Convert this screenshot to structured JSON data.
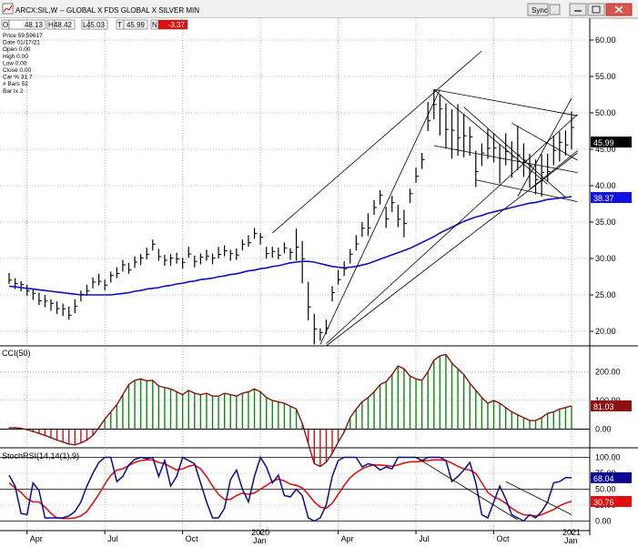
{
  "window": {
    "title": "ARCX:SIL,W -- GLOBAL X FDS GLOBAL X SILVER MIN",
    "sync_label": "Sync"
  },
  "ohlc_bar": {
    "labels": [
      "O",
      "H",
      "L",
      "T",
      "N"
    ],
    "values": [
      "48.13",
      "48.42",
      "45.03",
      "45.99",
      "-3.37"
    ]
  },
  "info_panel": [
    "Price  59.59617",
    "Date  01/17/21",
    "Open  0.00",
    "High  0.00",
    "Low  0.00",
    "Close  0.00",
    "Car %  31.7",
    "# Bars  52",
    "Bar Ix  2"
  ],
  "colors": {
    "ma": "#1010c0",
    "cci_up": "#0a8a0a",
    "cci_down": "#d01010",
    "cci_line": "#8b1010",
    "stoch_k": "#0a0a90",
    "stoch_d": "#e01010",
    "neg_box": "#e01010"
  },
  "chart_data": [
    {
      "type": "ohlc",
      "title": "ARCX:SIL,W -- GLOBAL X FDS GLOBAL X SILVER MIN",
      "ylim": [
        18,
        63
      ],
      "y_ticks": [
        20.0,
        25.0,
        30.0,
        35.0,
        40.0,
        45.0,
        50.0,
        55.0,
        60.0
      ],
      "x_tick_labels": [
        "Apr",
        "Jul",
        "Oct",
        "2020",
        "Jan",
        "Apr",
        "Jul",
        "Oct",
        "2021",
        "Jan"
      ],
      "price_tags": [
        "45.99",
        "38.37"
      ],
      "bars_high": [
        28,
        27.3,
        26.9,
        26.4,
        25.9,
        25.3,
        25,
        24.4,
        24.1,
        23.8,
        23.4,
        24.4,
        25.6,
        26.4,
        27.4,
        27.9,
        27.1,
        28.2,
        28.8,
        29.8,
        29.4,
        30.3,
        30.6,
        31.5,
        32.6,
        31.3,
        30.5,
        30.6,
        30.8,
        30.1,
        31.6,
        30.4,
        30.7,
        31.2,
        30.7,
        31.6,
        31.8,
        31.2,
        31.4,
        32.6,
        33.2,
        34.2,
        33.5,
        31.6,
        31.6,
        31.5,
        32.2,
        31.4,
        34.1,
        32.4,
        26.8,
        22.4,
        20.4,
        21.6,
        26.2,
        28.4,
        29.6,
        31.3,
        33.2,
        35,
        36.2,
        38,
        39.4,
        37.1,
        38.6,
        37.4,
        36.7,
        39.6,
        42.5,
        44.5,
        51.5,
        53.2,
        52.5,
        51.3,
        50.5,
        51.2,
        49.8,
        48.1,
        44.8,
        45.8,
        47.8,
        47.2,
        45.6,
        47.2,
        46.1,
        48.2,
        45.8,
        44.4,
        43.6,
        44.3,
        44.4,
        46.9,
        47.4,
        47.6,
        50.2
      ],
      "bars_low": [
        26.5,
        25.8,
        25.5,
        24.9,
        24.3,
        23.6,
        23.3,
        22.8,
        22.4,
        22.1,
        21.6,
        22.5,
        24.1,
        24.9,
        25.9,
        26.3,
        25.6,
        26.7,
        27.3,
        28.2,
        27.9,
        28.7,
        29.1,
        29.9,
        31.1,
        29.7,
        29,
        29,
        29.3,
        28.6,
        30.1,
        28.8,
        29.2,
        29.7,
        29.2,
        30,
        30.3,
        29.7,
        29.8,
        31.1,
        31.6,
        32.7,
        31.9,
        30,
        30.1,
        29.9,
        30.7,
        29.8,
        29.7,
        26.6,
        21.5,
        18.2,
        18.7,
        19.6,
        24.1,
        26.4,
        27.6,
        29.3,
        31.1,
        33,
        33.1,
        36,
        37.4,
        34.2,
        36.4,
        34.3,
        32.9,
        37.6,
        40.4,
        42.3,
        47.5,
        49.1,
        46.9,
        45.1,
        43.7,
        44.1,
        43.9,
        44.1,
        39.8,
        42.7,
        43.7,
        43.2,
        40.3,
        42.8,
        41.1,
        42.1,
        41.2,
        39.7,
        38.8,
        38.5,
        40.6,
        42.8,
        43.3,
        44.1,
        45
      ],
      "ma_values": [
        26.2,
        26.1,
        26,
        25.9,
        25.8,
        25.7,
        25.6,
        25.5,
        25.4,
        25.3,
        25.2,
        25.1,
        25,
        25,
        25,
        25,
        25,
        25,
        25.1,
        25.2,
        25.3,
        25.5,
        25.6,
        25.8,
        25.9,
        26,
        26.2,
        26.3,
        26.5,
        26.6,
        26.8,
        26.9,
        27.1,
        27.2,
        27.3,
        27.5,
        27.6,
        27.8,
        27.9,
        28.1,
        28.3,
        28.4,
        28.6,
        28.7,
        28.9,
        29,
        29.2,
        29.4,
        29.5,
        29.6,
        29.6,
        29.5,
        29.3,
        29.1,
        28.9,
        28.8,
        28.7,
        28.8,
        28.9,
        29.1,
        29.3,
        29.6,
        29.9,
        30.2,
        30.5,
        30.8,
        31.1,
        31.4,
        31.8,
        32.2,
        32.6,
        33,
        33.5,
        33.9,
        34.3,
        34.7,
        35.1,
        35.4,
        35.7,
        35.9,
        36.2,
        36.4,
        36.6,
        36.8,
        37,
        37.2,
        37.4,
        37.6,
        37.7,
        37.9,
        38.1,
        38.2,
        38.3,
        38.4,
        38.5
      ]
    },
    {
      "type": "bar",
      "title": "CCI(50)",
      "ylim": [
        -65,
        290
      ],
      "y_ticks": [
        0.0,
        100.0,
        200.0
      ],
      "last_value": "81.03",
      "values": [
        5,
        5,
        3,
        -2,
        -8,
        -15,
        -22,
        -30,
        -38,
        -45,
        -52,
        -55,
        -48,
        -38,
        -22,
        5,
        35,
        60,
        85,
        120,
        155,
        170,
        175,
        168,
        170,
        150,
        145,
        140,
        130,
        120,
        135,
        125,
        120,
        125,
        115,
        115,
        125,
        120,
        115,
        125,
        130,
        140,
        130,
        110,
        100,
        95,
        90,
        80,
        70,
        20,
        -50,
        -120,
        -130,
        -115,
        -85,
        -45,
        -10,
        40,
        70,
        95,
        110,
        130,
        155,
        165,
        190,
        220,
        210,
        185,
        175,
        170,
        200,
        240,
        255,
        260,
        230,
        210,
        190,
        160,
        135,
        110,
        90,
        100,
        90,
        75,
        60,
        50,
        40,
        30,
        30,
        40,
        55,
        60,
        70,
        75,
        81
      ]
    },
    {
      "type": "line",
      "title": "StochRSI(14,14(1),9)",
      "ylim": [
        -15,
        115
      ],
      "y_ticks": [
        0.0,
        25.0,
        50.0,
        75.0,
        100.0
      ],
      "series": [
        {
          "last_value": "68.04",
          "values": [
            72,
            55,
            12,
            10,
            60,
            48,
            5,
            5,
            5,
            5,
            8,
            15,
            30,
            55,
            75,
            92,
            100,
            100,
            62,
            70,
            88,
            97,
            100,
            98,
            100,
            70,
            95,
            55,
            70,
            100,
            95,
            90,
            60,
            30,
            5,
            5,
            20,
            65,
            80,
            50,
            30,
            70,
            100,
            85,
            60,
            72,
            40,
            38,
            50,
            40,
            5,
            0,
            5,
            25,
            70,
            95,
            100,
            100,
            100,
            85,
            90,
            88,
            80,
            85,
            82,
            100,
            100,
            100,
            100,
            95,
            100,
            100,
            100,
            95,
            62,
            70,
            80,
            92,
            60,
            10,
            5,
            30,
            55,
            35,
            10,
            5,
            0,
            10,
            5,
            15,
            30,
            60,
            62,
            68,
            68
          ]
        },
        {
          "last_value": "30.76",
          "values": [
            60,
            52,
            45,
            35,
            30,
            30,
            22,
            12,
            5,
            4,
            4,
            5,
            8,
            15,
            28,
            42,
            58,
            72,
            80,
            82,
            87,
            92,
            95,
            96,
            96,
            92,
            90,
            85,
            80,
            82,
            86,
            88,
            82,
            70,
            55,
            42,
            34,
            34,
            40,
            44,
            42,
            44,
            50,
            56,
            62,
            66,
            63,
            58,
            56,
            52,
            42,
            30,
            22,
            20,
            28,
            42,
            56,
            68,
            76,
            82,
            86,
            88,
            88,
            87,
            86,
            88,
            91,
            93,
            93,
            94,
            95,
            96,
            96,
            95,
            91,
            86,
            82,
            80,
            75,
            60,
            45,
            38,
            34,
            28,
            20,
            14,
            10,
            9,
            8,
            10,
            14,
            18,
            24,
            28,
            31
          ]
        }
      ]
    }
  ]
}
